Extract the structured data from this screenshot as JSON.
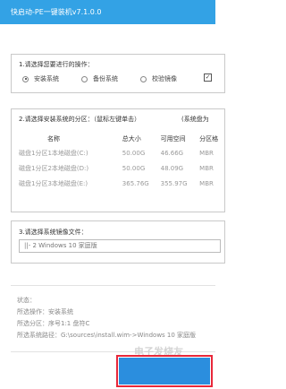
{
  "window": {
    "title": "快启动-PE一键装机v7.1.0.0"
  },
  "operation": {
    "heading": "1.请选择您要进行的操作：",
    "options": [
      "安装系统",
      "备份系统",
      "校验镜像"
    ],
    "selected": "安装系统",
    "checkbox_checked": true,
    "checkbox_mark": "✓"
  },
  "partition": {
    "heading": "2.请选择安装系统的分区：（鼠标左键单击）",
    "extra_label": "(系统盘为",
    "columns": [
      "名称",
      "总大小",
      "可用空间",
      "分区格"
    ],
    "rows": [
      [
        "磁盘1分区1本地磁盘(C:)",
        "50.00G",
        "46.66G",
        "MBR"
      ],
      [
        "磁盘1分区2本地磁盘(D:)",
        "50.00G",
        "48.09G",
        "MBR"
      ],
      [
        "磁盘1分区3本地磁盘(E:)",
        "365.76G",
        "355.97G",
        "MBR"
      ]
    ]
  },
  "image": {
    "heading": "3.请选择系统镜像文件：",
    "value": "||- 2 Windows  10 家庭版"
  },
  "status": {
    "lines": [
      "状态：",
      "所选操作：安装系统",
      "所选分区：序号1:1   盘符C",
      "所选系统路径：G:\\sources\\install.wim->Windows  10 家庭版"
    ]
  },
  "footer": {
    "brand_watermark": "电子发烧友",
    "action_label": ""
  },
  "colors": {
    "titlebar": "#33a2e5",
    "highlight_border": "#e8283a",
    "action_button": "#2b8ede"
  }
}
